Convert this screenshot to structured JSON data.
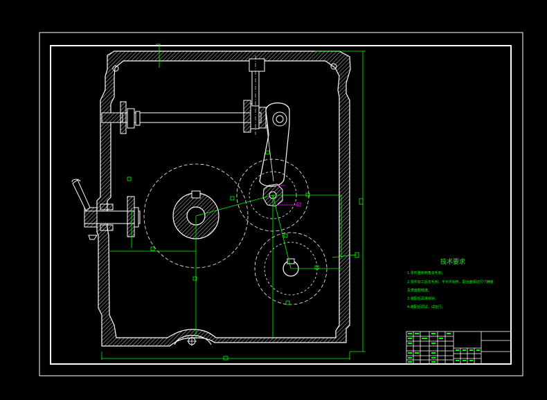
{
  "technical_requirements": {
    "title": "技术要求",
    "items": [
      "1.零件整体倒角去毛刺。",
      "2.零件加工后去毛刺，不允许划伤，配合面保证尺寸精度",
      "  及表面粗糙度。",
      "3.装配后润滑良好。",
      "4.装配后调试，试运行。"
    ]
  },
  "colors": {
    "background": "#000000",
    "outline": "#ffffff",
    "dimension": "#00ff00",
    "highlight": "#ff00ff"
  }
}
